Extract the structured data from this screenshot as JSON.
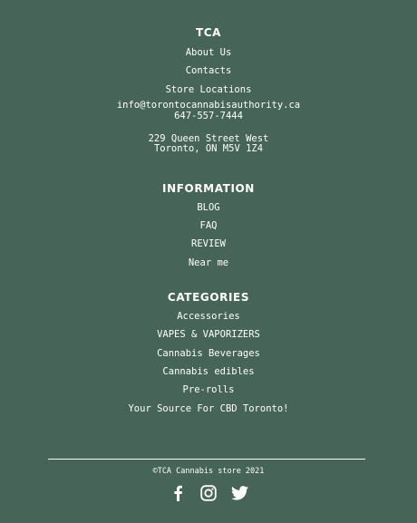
{
  "tca": {
    "heading": "TCA",
    "links": [
      "About Us",
      "Contacts",
      "Store Locations"
    ],
    "email": "info@torontocannabisauthority.ca",
    "phone": "647-557-7444",
    "address_line1": "229 Queen Street West",
    "address_line2": "Toronto, ON M5V 1Z4"
  },
  "information": {
    "heading": "INFORMATION",
    "links": [
      "BLOG",
      "FAQ",
      "REVIEW",
      "Near me"
    ]
  },
  "categories": {
    "heading": "CATEGORIES",
    "links": [
      "Accessories",
      "VAPES & VAPORIZERS",
      "Cannabis Beverages",
      "Cannabis edibles",
      "Pre-rolls",
      "Your Source For CBD Toronto!"
    ]
  },
  "bottom": {
    "copyright": "©TCA Cannabis store 2021",
    "social_icons": [
      "facebook-icon",
      "instagram-icon",
      "twitter-icon"
    ]
  },
  "colors": {
    "background": "#466458",
    "text": "#ffffff"
  }
}
